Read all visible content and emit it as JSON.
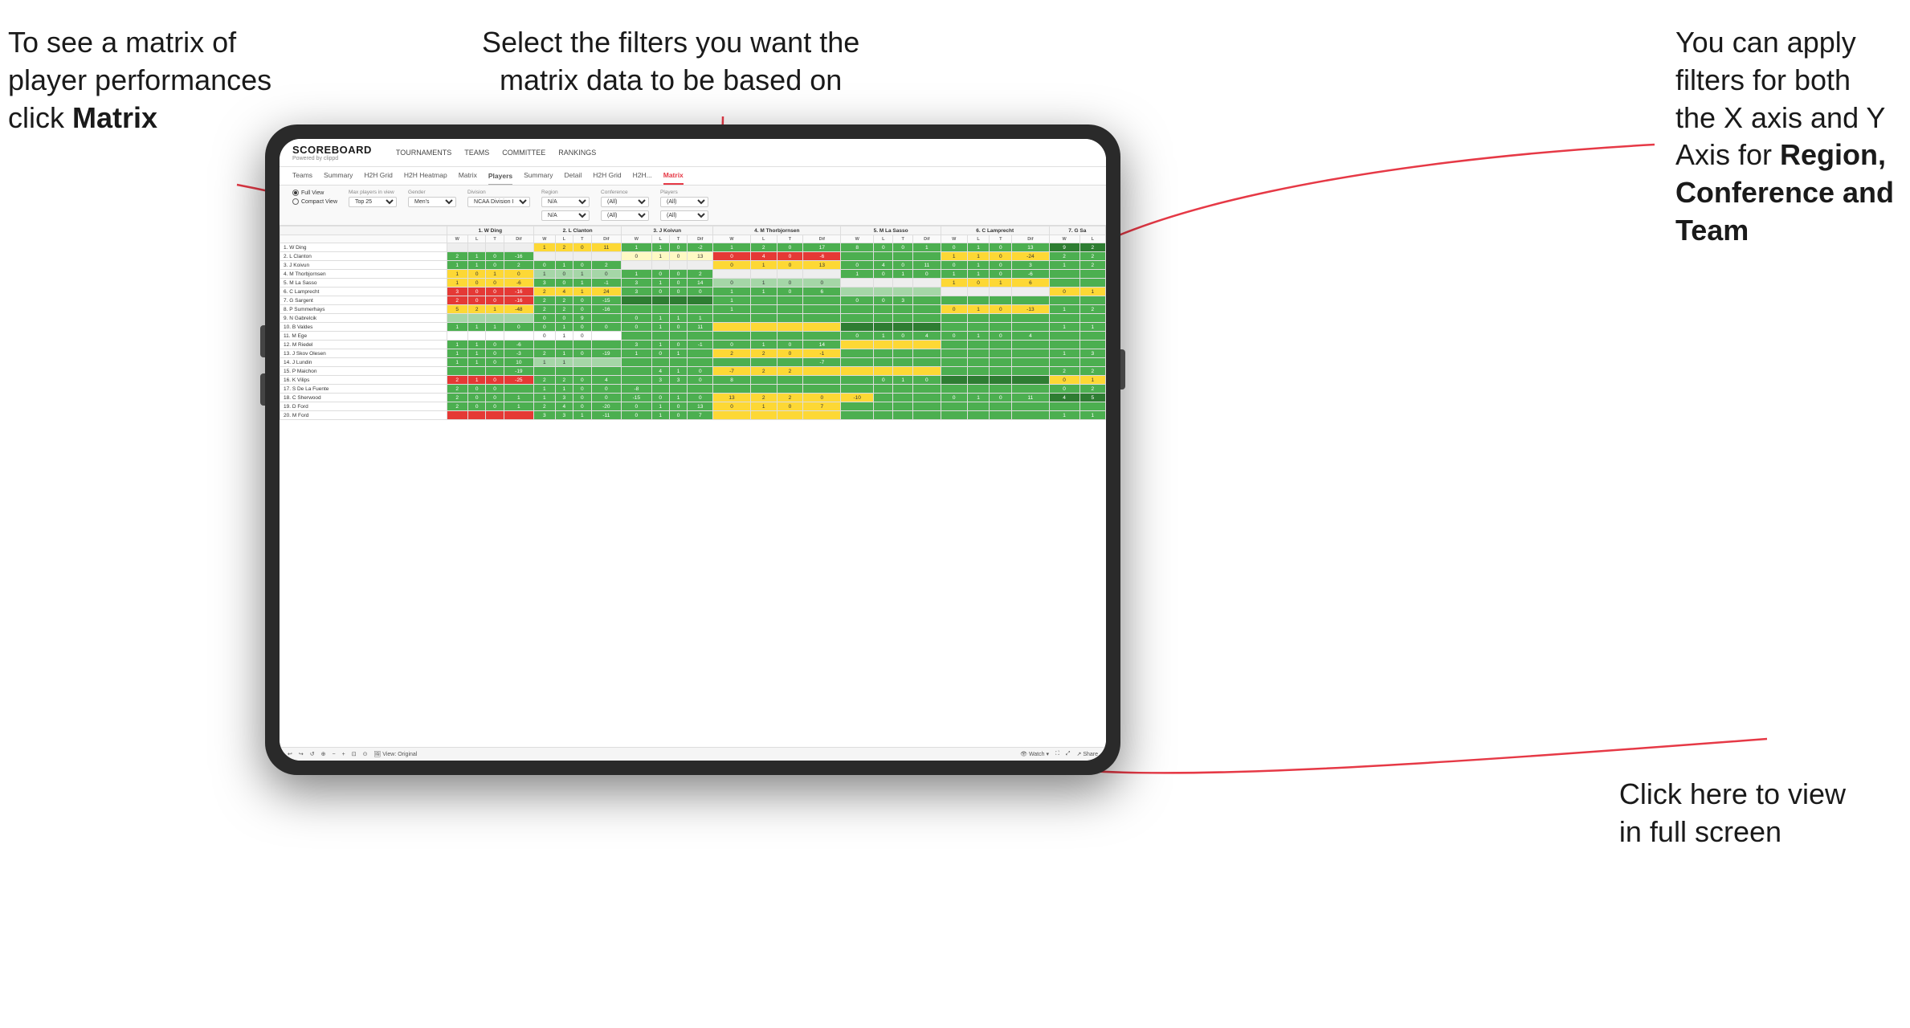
{
  "annotations": {
    "top_left": {
      "line1": "To see a matrix of",
      "line2": "player performances",
      "line3_normal": "click ",
      "line3_bold": "Matrix"
    },
    "top_center": {
      "line1": "Select the filters you want the",
      "line2": "matrix data to be based on"
    },
    "top_right": {
      "line1": "You  can apply",
      "line2": "filters for both",
      "line3": "the X axis and Y",
      "line4_normal": "Axis for ",
      "line4_bold": "Region,",
      "line5_bold": "Conference and",
      "line6_bold": "Team"
    },
    "bottom_right": {
      "line1": "Click here to view",
      "line2": "in full screen"
    }
  },
  "app": {
    "logo_title": "SCOREBOARD",
    "logo_subtitle": "Powered by clippd",
    "nav": [
      "TOURNAMENTS",
      "TEAMS",
      "COMMITTEE",
      "RANKINGS"
    ],
    "sub_nav": [
      "Teams",
      "Summary",
      "H2H Grid",
      "H2H Heatmap",
      "Matrix",
      "Players",
      "Summary",
      "Detail",
      "H2H Grid",
      "H2H...",
      "Matrix"
    ],
    "active_tab": "Matrix"
  },
  "filters": {
    "view_options": [
      "Full View",
      "Compact View"
    ],
    "selected_view": "Full View",
    "max_players_label": "Max players in view",
    "max_players_value": "Top 25",
    "gender_label": "Gender",
    "gender_value": "Men's",
    "division_label": "Division",
    "division_value": "NCAA Division I",
    "region_label": "Region",
    "region_value": "N/A",
    "conference_label": "Conference",
    "conference_value": "(All)",
    "players_label": "Players",
    "players_value": "(All)"
  },
  "matrix": {
    "column_headers": [
      "1. W Ding",
      "2. L Clanton",
      "3. J Koivun",
      "4. M Thorbjornsen",
      "5. M La Sasso",
      "6. C Lamprecht",
      "7. G Sa"
    ],
    "sub_headers": [
      "W",
      "L",
      "T",
      "Dif"
    ],
    "rows": [
      {
        "name": "1. W Ding",
        "num": "1"
      },
      {
        "name": "2. L Clanton",
        "num": "2"
      },
      {
        "name": "3. J Koivun",
        "num": "3"
      },
      {
        "name": "4. M Thorbjornsen",
        "num": "4"
      },
      {
        "name": "5. M La Sasso",
        "num": "5"
      },
      {
        "name": "6. C Lamprecht",
        "num": "6"
      },
      {
        "name": "7. G Sargent",
        "num": "7"
      },
      {
        "name": "8. P Summerhays",
        "num": "8"
      },
      {
        "name": "9. N Gabrelcik",
        "num": "9"
      },
      {
        "name": "10. B Valdes",
        "num": "10"
      },
      {
        "name": "11. M Ege",
        "num": "11"
      },
      {
        "name": "12. M Riedel",
        "num": "12"
      },
      {
        "name": "13. J Skov Olesen",
        "num": "13"
      },
      {
        "name": "14. J Lundin",
        "num": "14"
      },
      {
        "name": "15. P Maichon",
        "num": "15"
      },
      {
        "name": "16. K Vilips",
        "num": "16"
      },
      {
        "name": "17. S De La Fuente",
        "num": "17"
      },
      {
        "name": "18. C Sherwood",
        "num": "18"
      },
      {
        "name": "19. D Ford",
        "num": "19"
      },
      {
        "name": "20. M Ford",
        "num": "20"
      }
    ]
  },
  "toolbar": {
    "view_original": "View: Original",
    "watch": "Watch",
    "share": "Share"
  }
}
